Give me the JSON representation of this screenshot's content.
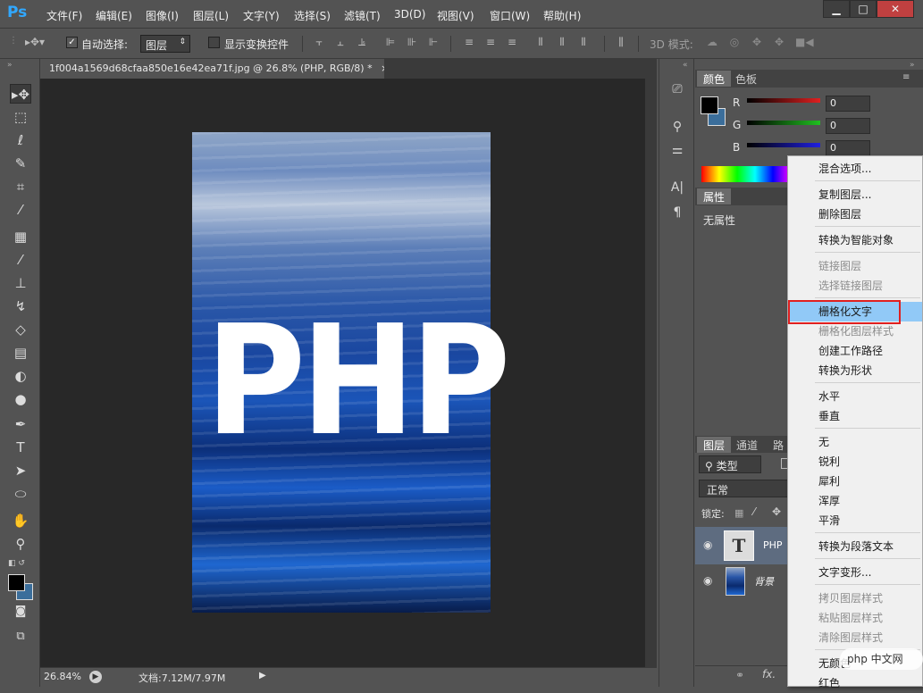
{
  "app": {
    "logo": "Ps"
  },
  "menu": [
    "文件(F)",
    "编辑(E)",
    "图像(I)",
    "图层(L)",
    "文字(Y)",
    "选择(S)",
    "滤镜(T)",
    "3D(D)",
    "视图(V)",
    "窗口(W)",
    "帮助(H)"
  ],
  "window_buttons": [
    "▁",
    "□",
    "✕"
  ],
  "options": {
    "auto_select_label": "自动选择:",
    "auto_select_value": "图层",
    "show_transform_label": "显示变换控件",
    "mode_3d_label": "3D 模式:"
  },
  "document": {
    "tab_title": "1f004a1569d68cfaa850e16e42ea71f.jpg @ 26.8% (PHP, RGB/8) *",
    "close": "×",
    "canvas_text": "PHP"
  },
  "status": {
    "zoom": "26.84%",
    "doc_size": "文档:7.12M/7.97M"
  },
  "color_panel": {
    "tabs": [
      "颜色",
      "色板"
    ],
    "channels": [
      {
        "name": "R",
        "value": "0",
        "color": "#e02020"
      },
      {
        "name": "G",
        "value": "0",
        "color": "#20c020"
      },
      {
        "name": "B",
        "value": "0",
        "color": "#2020e0"
      }
    ]
  },
  "properties_panel": {
    "tab": "属性",
    "content": "无属性"
  },
  "layers_panel": {
    "tabs": [
      "图层",
      "通道",
      "路径"
    ],
    "filter_label": "类型",
    "blend_mode": "正常",
    "lock_label": "锁定:",
    "layers": [
      {
        "name": "PHP",
        "type": "text",
        "selected": true
      },
      {
        "name": "背景",
        "type": "image",
        "selected": false
      }
    ]
  },
  "context_menu": {
    "items": [
      {
        "label": "混合选项...",
        "disabled": false
      },
      {
        "label": "复制图层...",
        "disabled": false
      },
      {
        "label": "删除图层",
        "disabled": false
      },
      {
        "label": "转换为智能对象",
        "disabled": false
      },
      {
        "label": "链接图层",
        "disabled": true
      },
      {
        "label": "选择链接图层",
        "disabled": true
      },
      {
        "label": "栅格化文字",
        "disabled": false,
        "highlighted": true
      },
      {
        "label": "栅格化图层样式",
        "disabled": true
      },
      {
        "label": "创建工作路径",
        "disabled": false
      },
      {
        "label": "转换为形状",
        "disabled": false
      },
      {
        "label": "水平",
        "disabled": false
      },
      {
        "label": "垂直",
        "disabled": false
      },
      {
        "label": "无",
        "disabled": false
      },
      {
        "label": "锐利",
        "disabled": false
      },
      {
        "label": "犀利",
        "disabled": false
      },
      {
        "label": "浑厚",
        "disabled": false
      },
      {
        "label": "平滑",
        "disabled": false
      },
      {
        "label": "转换为段落文本",
        "disabled": false
      },
      {
        "label": "文字变形...",
        "disabled": false
      },
      {
        "label": "拷贝图层样式",
        "disabled": true
      },
      {
        "label": "粘贴图层样式",
        "disabled": true
      },
      {
        "label": "清除图层样式",
        "disabled": true
      },
      {
        "label": "无颜色",
        "disabled": false
      },
      {
        "label": "红色",
        "disabled": false
      }
    ]
  },
  "watermark": "php 中文网",
  "colors": {
    "accent": "#31a8ff",
    "highlight": "#91c9f7",
    "annotation": "#e02020"
  }
}
